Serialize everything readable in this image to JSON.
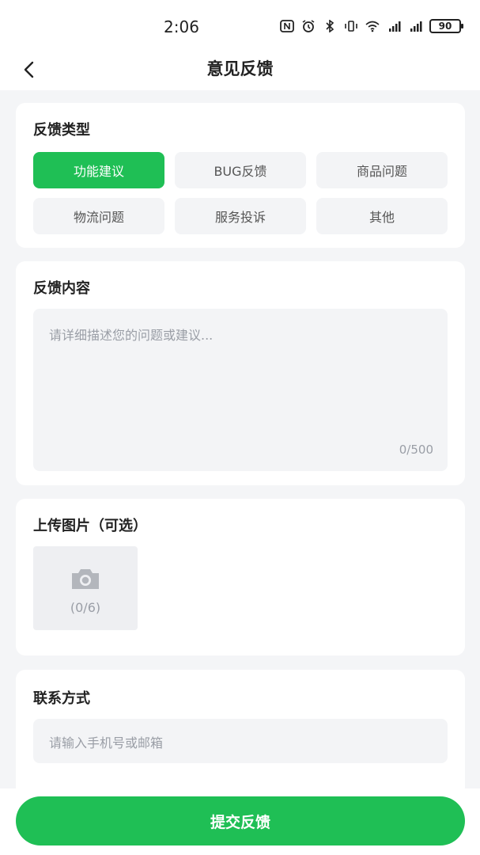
{
  "status_bar": {
    "time": "2:06",
    "battery": "90",
    "icons": [
      "nfc-icon",
      "alarm-icon",
      "bluetooth-icon",
      "vibrate-icon",
      "wifi-icon",
      "signal-4g-icon",
      "signal-4g-icon"
    ]
  },
  "nav": {
    "back_icon": "chevron-left-icon",
    "title": "意见反馈"
  },
  "feedback_type": {
    "title": "反馈类型",
    "options": [
      "功能建议",
      "BUG反馈",
      "商品问题",
      "物流问题",
      "服务投诉",
      "其他"
    ],
    "selected": "功能建议"
  },
  "feedback_content": {
    "title": "反馈内容",
    "placeholder": "请详细描述您的问题或建议...",
    "counter": "0/500"
  },
  "upload": {
    "title": "上传图片（可选）",
    "icon": "camera-icon",
    "counter": "(0/6)"
  },
  "contact": {
    "title": "联系方式",
    "placeholder": "请输入手机号或邮箱"
  },
  "submit": {
    "label": "提交反馈"
  },
  "colors": {
    "accent": "#1fbf55",
    "field_bg": "#f3f4f6",
    "page_bg": "#f4f5f7",
    "placeholder": "#9a9ea6"
  }
}
